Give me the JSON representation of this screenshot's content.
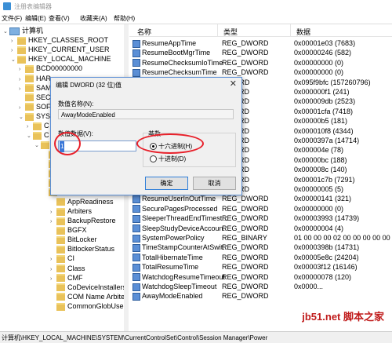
{
  "window": {
    "title": "注册表编辑器"
  },
  "menu": [
    "文件(F)",
    "编辑(E)",
    "查看(V)",
    "收藏夹(A)",
    "帮助(H)"
  ],
  "tree": [
    {
      "label": "计算机",
      "icon": "computer-icon",
      "twisty": "⌄"
    },
    {
      "label": "HKEY_CLASSES_ROOT",
      "icon": "folder-icon",
      "twisty": "›"
    },
    {
      "label": "HKEY_CURRENT_USER",
      "icon": "folder-icon",
      "twisty": "›"
    },
    {
      "label": "HKEY_LOCAL_MACHINE",
      "icon": "folder-icon",
      "twisty": "⌄"
    },
    {
      "label": "BCD00000000",
      "icon": "folder-icon",
      "twisty": "›"
    },
    {
      "label": "HAR",
      "icon": "folder-icon",
      "twisty": "›"
    },
    {
      "label": "SAM",
      "icon": "folder-icon",
      "twisty": "›"
    },
    {
      "label": "SEC",
      "icon": "folder-icon",
      "twisty": ""
    },
    {
      "label": "SOF",
      "icon": "folder-icon",
      "twisty": "›"
    },
    {
      "label": "SYS",
      "icon": "folder-icon",
      "twisty": "⌄"
    },
    {
      "label": "C",
      "icon": "folder-icon",
      "twisty": "›"
    },
    {
      "label": "C",
      "icon": "folder-icon",
      "twisty": "⌄"
    },
    {
      "label": "",
      "icon": "folder-icon",
      "twisty": "⌄"
    },
    {
      "label": "",
      "icon": "folder-icon",
      "twisty": ""
    },
    {
      "label": "",
      "icon": "folder-icon",
      "twisty": ""
    },
    {
      "label": "",
      "icon": "folder-icon",
      "twisty": ""
    },
    {
      "label": "",
      "icon": "folder-icon",
      "twisty": ""
    },
    {
      "label": "",
      "icon": "folder-icon",
      "twisty": ""
    },
    {
      "label": "AppReadiness",
      "icon": "folder-icon",
      "twisty": ""
    },
    {
      "label": "Arbiters",
      "icon": "folder-icon",
      "twisty": "›"
    },
    {
      "label": "BackupRestore",
      "icon": "folder-icon",
      "twisty": "›"
    },
    {
      "label": "BGFX",
      "icon": "folder-icon",
      "twisty": ""
    },
    {
      "label": "BitLocker",
      "icon": "folder-icon",
      "twisty": ""
    },
    {
      "label": "BitlockerStatus",
      "icon": "folder-icon",
      "twisty": ""
    },
    {
      "label": "CI",
      "icon": "folder-icon",
      "twisty": "›"
    },
    {
      "label": "Class",
      "icon": "folder-icon",
      "twisty": "›"
    },
    {
      "label": "CMF",
      "icon": "folder-icon",
      "twisty": "›"
    },
    {
      "label": "CoDeviceInstallers",
      "icon": "folder-icon",
      "twisty": ""
    },
    {
      "label": "COM Name Arbiter",
      "icon": "folder-icon",
      "twisty": ""
    },
    {
      "label": "CommonGlobUserS",
      "icon": "folder-icon",
      "twisty": ""
    }
  ],
  "list": {
    "headers": {
      "name": "名称",
      "type": "类型",
      "data": "数据"
    },
    "rows": [
      {
        "name": "ResumeAppTime",
        "type": "REG_DWORD",
        "data": "0x00001e03 (7683)"
      },
      {
        "name": "ResumeBootMgrTime",
        "type": "REG_DWORD",
        "data": "0x00000246 (582)"
      },
      {
        "name": "ResumeChecksumIoTime",
        "type": "REG_DWORD",
        "data": "0x00000000 (0)"
      },
      {
        "name": "ResumeChecksumTime",
        "type": "REG_DWORD",
        "data": "0x00000000 (0)"
      },
      {
        "name": "",
        "type": "QWORD",
        "data": "0x095f9bfc (157260796)"
      },
      {
        "name": "",
        "type": "DWORD",
        "data": "0x000000f1 (241)"
      },
      {
        "name": "",
        "type": "DWORD",
        "data": "0x000009db (2523)"
      },
      {
        "name": "",
        "type": "DWORD",
        "data": "0x00001cfa (7418)"
      },
      {
        "name": "",
        "type": "DWORD",
        "data": "0x00000b5 (181)"
      },
      {
        "name": "",
        "type": "DWORD",
        "data": "0x000010f8 (4344)"
      },
      {
        "name": "",
        "type": "DWORD",
        "data": "0x0000397a (14714)"
      },
      {
        "name": "",
        "type": "DWORD",
        "data": "0x000004e (78)"
      },
      {
        "name": "",
        "type": "DWORD",
        "data": "0x00000bc (188)"
      },
      {
        "name": "",
        "type": "DWORD",
        "data": "0x000008c (140)"
      },
      {
        "name": "",
        "type": "DWORD",
        "data": "0x00001c7b (7291)"
      },
      {
        "name": "",
        "type": "DWORD",
        "data": "0x00000005 (5)"
      },
      {
        "name": "ResumeUserInOutTime",
        "type": "REG_DWORD",
        "data": "0x00000141 (321)"
      },
      {
        "name": "SecurePagesProcessed",
        "type": "REG_DWORD",
        "data": "0x00000000 (0)"
      },
      {
        "name": "SleeperThreadEndTimest...",
        "type": "REG_DWORD",
        "data": "0x00003993 (14739)"
      },
      {
        "name": "SleepStudyDeviceAccoun...",
        "type": "REG_DWORD",
        "data": "0x00000004 (4)"
      },
      {
        "name": "SystemPowerPolicy",
        "type": "REG_BINARY",
        "data": "01 00 00 00 02 00 00 00 00 00"
      },
      {
        "name": "TimeStampCounterAtSwit...",
        "type": "REG_DWORD",
        "data": "0x0000398b (14731)"
      },
      {
        "name": "TotalHibernateTime",
        "type": "REG_DWORD",
        "data": "0x00005e8c (24204)"
      },
      {
        "name": "TotalResumeTime",
        "type": "REG_DWORD",
        "data": "0x00003f12 (16146)"
      },
      {
        "name": "WatchdogResumeTimeout",
        "type": "REG_DWORD",
        "data": "0x00000078 (120)"
      },
      {
        "name": "WatchdogSleepTimeout",
        "type": "REG_DWORD",
        "data": "0x0000..."
      },
      {
        "name": "AwayModeEnabled",
        "type": "REG_DWORD",
        "data": ""
      }
    ]
  },
  "dialog": {
    "title": "编辑 DWORD (32 位)值",
    "close": "✕",
    "name_label": "数值名称(N):",
    "name_value": "AwayModeEnabled",
    "data_label": "数值数据(V):",
    "data_value": "1",
    "base_label": "基数",
    "hex_label": "十六进制(H)",
    "dec_label": "十进制(D)",
    "ok": "确定",
    "cancel": "取消"
  },
  "status": "计算机\\HKEY_LOCAL_MACHINE\\SYSTEM\\CurrentControlSet\\Control\\Session Manager\\Power",
  "watermark": "jb51.net 脚本之家"
}
